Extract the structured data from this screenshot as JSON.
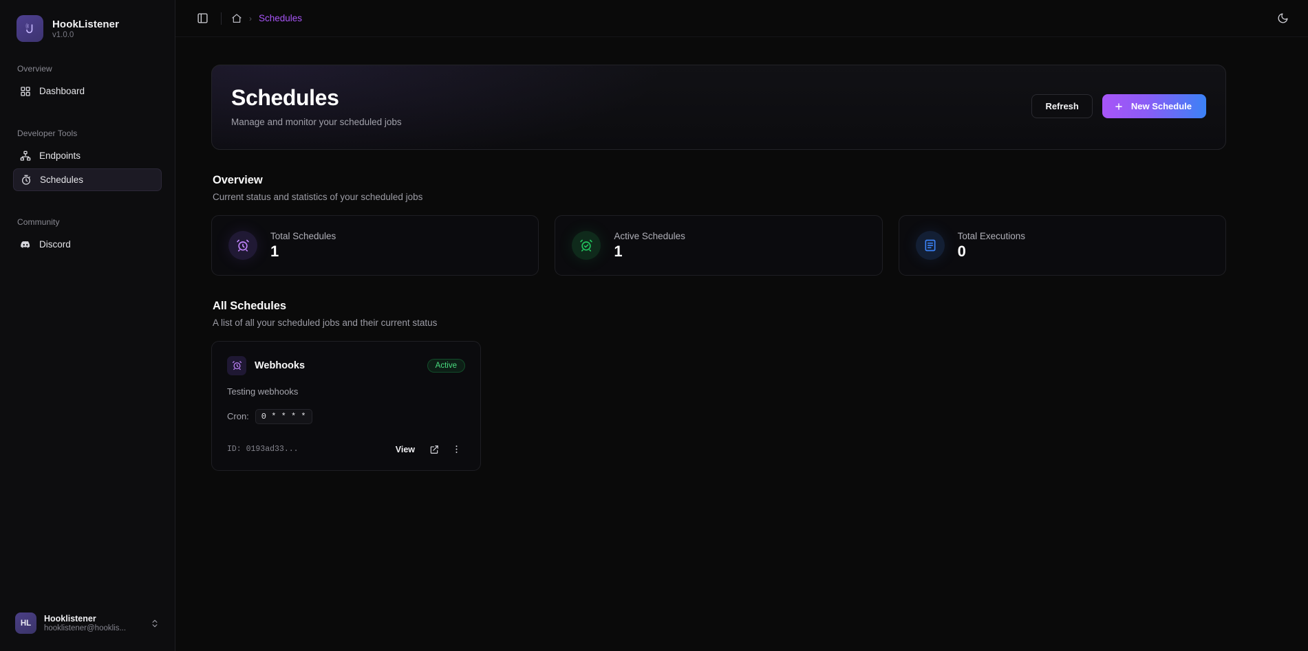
{
  "brand": {
    "name": "HookListener",
    "version": "v1.0.0",
    "logo_icon": "hook-logo-icon"
  },
  "sidebar": {
    "groups": [
      {
        "label": "Overview",
        "items": [
          {
            "label": "Dashboard",
            "icon": "grid-icon",
            "active": false
          }
        ]
      },
      {
        "label": "Developer Tools",
        "items": [
          {
            "label": "Endpoints",
            "icon": "network-icon",
            "active": false
          },
          {
            "label": "Schedules",
            "icon": "timer-icon",
            "active": true
          }
        ]
      },
      {
        "label": "Community",
        "items": [
          {
            "label": "Discord",
            "icon": "discord-icon",
            "active": false
          }
        ]
      }
    ],
    "user": {
      "initials": "HL",
      "name": "Hooklistener",
      "email": "hooklistener@hooklis...",
      "chevron_icon": "chevrons-up-down-icon"
    }
  },
  "topbar": {
    "sidebar_toggle_icon": "panel-left-icon",
    "home_icon": "home-icon",
    "breadcrumb_separator": "›",
    "breadcrumb_current": "Schedules",
    "theme_toggle_icon": "moon-icon"
  },
  "hero": {
    "title": "Schedules",
    "subtitle": "Manage and monitor your scheduled jobs",
    "refresh_label": "Refresh",
    "new_schedule_label": "New Schedule",
    "new_schedule_icon": "plus-icon"
  },
  "overview": {
    "title": "Overview",
    "subtitle": "Current status and statistics of your scheduled jobs",
    "stats": [
      {
        "label": "Total Schedules",
        "value": "1",
        "icon": "alarm-clock-icon",
        "color": "#c084fc",
        "tone": "purple"
      },
      {
        "label": "Active Schedules",
        "value": "1",
        "icon": "alarm-clock-check-icon",
        "color": "#22c55e",
        "tone": "green"
      },
      {
        "label": "Total Executions",
        "value": "0",
        "icon": "list-activity-icon",
        "color": "#3b82f6",
        "tone": "blue"
      }
    ]
  },
  "all_schedules": {
    "title": "All Schedules",
    "subtitle": "A list of all your scheduled jobs and their current status",
    "cards": [
      {
        "icon": "alarm-clock-icon",
        "name": "Webhooks",
        "status": "Active",
        "description": "Testing webhooks",
        "cron_label": "Cron:",
        "cron_value": "0 * * * *",
        "id_text": "ID: 0193ad33...",
        "view_label": "View",
        "open_icon": "external-link-icon",
        "menu_icon": "more-vertical-icon"
      }
    ]
  },
  "colors": {
    "accent_purple": "#a855f7",
    "accent_blue": "#3b82f6",
    "status_green": "#4ade80",
    "page_bg": "#0a0a0a",
    "sidebar_bg": "#0d0d0f",
    "card_bg": "#0b0b0e",
    "border": "#1f1f24"
  }
}
